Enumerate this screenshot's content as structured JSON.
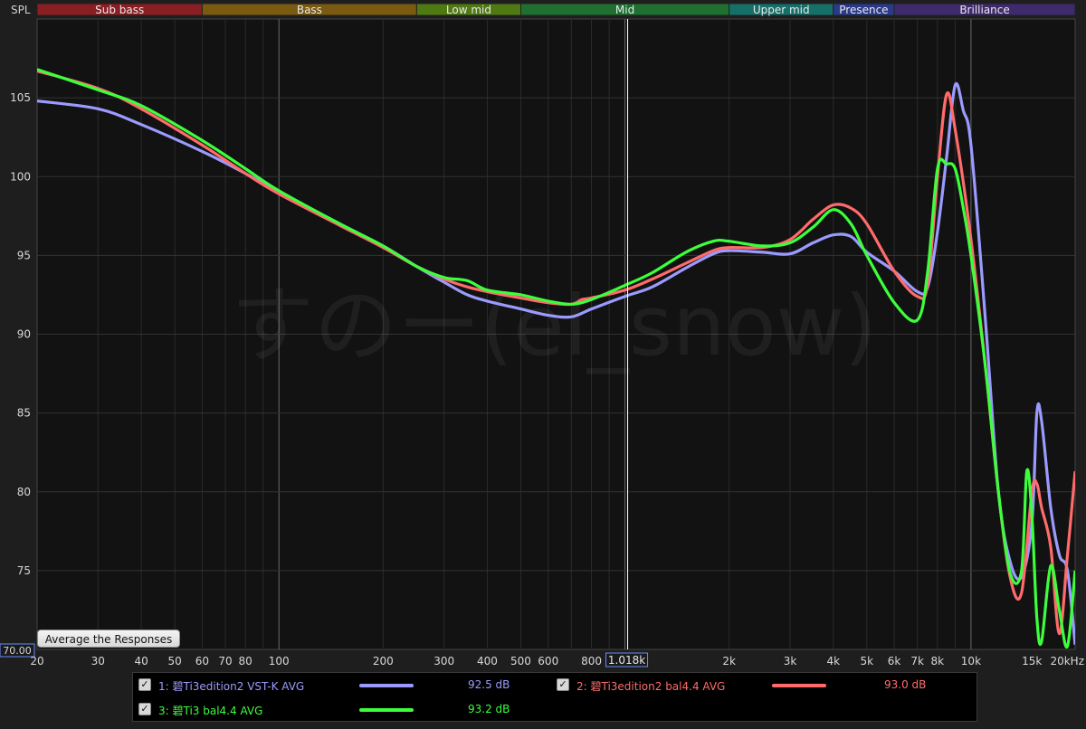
{
  "chart_data": {
    "type": "line",
    "ylabel": "SPL",
    "xscale": "log",
    "xlim": [
      20,
      20000
    ],
    "ylim": [
      70,
      110
    ],
    "grid": true,
    "y_ticks": [
      "75",
      "80",
      "85",
      "90",
      "95",
      "100",
      "105"
    ],
    "y_min_label": "70.00",
    "x_ticks": [
      "20",
      "30",
      "40",
      "50",
      "60",
      "70",
      "80",
      "100",
      "200",
      "300",
      "400",
      "500",
      "600",
      "800",
      "2k",
      "3k",
      "4k",
      "5k",
      "6k",
      "7k",
      "8k",
      "10k",
      "15k",
      "20kHz"
    ],
    "cursor_label": "1.018k",
    "watermark": "すのー(el_snow)",
    "bands": [
      {
        "name": "Sub bass",
        "from": 20,
        "to": 60,
        "color": "#8b1e23"
      },
      {
        "name": "Bass",
        "from": 60,
        "to": 250,
        "color": "#7a5a10"
      },
      {
        "name": "Low mid",
        "from": 250,
        "to": 500,
        "color": "#4f7a12"
      },
      {
        "name": "Mid",
        "from": 500,
        "to": 2000,
        "color": "#1f7030"
      },
      {
        "name": "Upper mid",
        "from": 2000,
        "to": 4000,
        "color": "#16706a"
      },
      {
        "name": "Presence",
        "from": 4000,
        "to": 6000,
        "color": "#2a3a8a"
      },
      {
        "name": "Brilliance",
        "from": 6000,
        "to": 20000,
        "color": "#3f2a6e"
      }
    ],
    "series": [
      {
        "name": "1: 碧Ti3edition2 VST-K AVG",
        "color": "#9b9bff",
        "avg": "92.5 dB",
        "points": [
          [
            20,
            104.8
          ],
          [
            30,
            104.3
          ],
          [
            40,
            103.3
          ],
          [
            60,
            101.6
          ],
          [
            80,
            100.2
          ],
          [
            100,
            99.0
          ],
          [
            150,
            97.0
          ],
          [
            200,
            95.6
          ],
          [
            250,
            94.3
          ],
          [
            300,
            93.3
          ],
          [
            350,
            92.5
          ],
          [
            400,
            92.1
          ],
          [
            500,
            91.6
          ],
          [
            600,
            91.2
          ],
          [
            700,
            91.1
          ],
          [
            800,
            91.6
          ],
          [
            1000,
            92.4
          ],
          [
            1200,
            93.0
          ],
          [
            1500,
            94.2
          ],
          [
            1800,
            95.1
          ],
          [
            2000,
            95.3
          ],
          [
            2500,
            95.2
          ],
          [
            3000,
            95.1
          ],
          [
            3500,
            95.8
          ],
          [
            4000,
            96.3
          ],
          [
            4500,
            96.2
          ],
          [
            5000,
            95.2
          ],
          [
            6000,
            94.0
          ],
          [
            7000,
            92.7
          ],
          [
            7500,
            93.0
          ],
          [
            8000,
            96.5
          ],
          [
            8500,
            101.2
          ],
          [
            9000,
            105.8
          ],
          [
            9500,
            104.2
          ],
          [
            10000,
            102.0
          ],
          [
            11000,
            91.0
          ],
          [
            12000,
            80.0
          ],
          [
            13000,
            75.5
          ],
          [
            14000,
            74.6
          ],
          [
            15000,
            78.0
          ],
          [
            15500,
            85.0
          ],
          [
            16000,
            84.5
          ],
          [
            17000,
            79.0
          ],
          [
            18000,
            76.0
          ],
          [
            19000,
            75.0
          ],
          [
            20000,
            70.3
          ]
        ]
      },
      {
        "name": "2: 碧Ti3edition2 bal4.4 AVG",
        "color": "#ff6b6b",
        "avg": "93.0 dB",
        "points": [
          [
            20,
            106.7
          ],
          [
            30,
            105.6
          ],
          [
            40,
            104.3
          ],
          [
            60,
            102.0
          ],
          [
            80,
            100.2
          ],
          [
            100,
            98.9
          ],
          [
            150,
            96.9
          ],
          [
            200,
            95.5
          ],
          [
            250,
            94.3
          ],
          [
            300,
            93.5
          ],
          [
            350,
            93.0
          ],
          [
            400,
            92.7
          ],
          [
            500,
            92.3
          ],
          [
            600,
            92.0
          ],
          [
            700,
            91.9
          ],
          [
            750,
            92.2
          ],
          [
            800,
            92.3
          ],
          [
            1000,
            92.8
          ],
          [
            1200,
            93.5
          ],
          [
            1500,
            94.5
          ],
          [
            1800,
            95.3
          ],
          [
            2000,
            95.5
          ],
          [
            2500,
            95.5
          ],
          [
            3000,
            96.0
          ],
          [
            3500,
            97.3
          ],
          [
            4000,
            98.2
          ],
          [
            4500,
            98.0
          ],
          [
            5000,
            97.0
          ],
          [
            6000,
            94.0
          ],
          [
            7000,
            92.4
          ],
          [
            7500,
            93.2
          ],
          [
            8000,
            100.0
          ],
          [
            8500,
            105.2
          ],
          [
            9000,
            103.0
          ],
          [
            10000,
            96.0
          ],
          [
            11000,
            88.0
          ],
          [
            12000,
            80.0
          ],
          [
            13000,
            74.5
          ],
          [
            14000,
            73.6
          ],
          [
            15000,
            80.0
          ],
          [
            15500,
            80.5
          ],
          [
            16000,
            79.0
          ],
          [
            17000,
            76.5
          ],
          [
            18000,
            71.0
          ],
          [
            19000,
            76.0
          ],
          [
            20000,
            81.3
          ]
        ]
      },
      {
        "name": "3: 碧Ti3 bal4.4 AVG",
        "color": "#3cff3c",
        "avg": "93.2 dB",
        "points": [
          [
            20,
            106.8
          ],
          [
            30,
            105.5
          ],
          [
            40,
            104.5
          ],
          [
            60,
            102.3
          ],
          [
            80,
            100.5
          ],
          [
            100,
            99.1
          ],
          [
            150,
            97.0
          ],
          [
            200,
            95.6
          ],
          [
            250,
            94.3
          ],
          [
            300,
            93.6
          ],
          [
            350,
            93.4
          ],
          [
            400,
            92.8
          ],
          [
            500,
            92.5
          ],
          [
            600,
            92.1
          ],
          [
            700,
            91.9
          ],
          [
            800,
            92.2
          ],
          [
            1000,
            93.1
          ],
          [
            1200,
            93.9
          ],
          [
            1500,
            95.2
          ],
          [
            1800,
            95.9
          ],
          [
            2000,
            95.9
          ],
          [
            2500,
            95.6
          ],
          [
            3000,
            95.8
          ],
          [
            3500,
            96.8
          ],
          [
            4000,
            97.9
          ],
          [
            4500,
            97.0
          ],
          [
            5000,
            95.0
          ],
          [
            6000,
            92.0
          ],
          [
            7000,
            90.9
          ],
          [
            7500,
            94.0
          ],
          [
            8000,
            100.5
          ],
          [
            8500,
            100.8
          ],
          [
            9000,
            100.5
          ],
          [
            9500,
            98.0
          ],
          [
            10000,
            95.0
          ],
          [
            11000,
            88.0
          ],
          [
            12000,
            80.0
          ],
          [
            13000,
            74.8
          ],
          [
            14000,
            75.0
          ],
          [
            14500,
            81.3
          ],
          [
            15000,
            78.5
          ],
          [
            15500,
            72.0
          ],
          [
            16000,
            70.5
          ],
          [
            17000,
            75.3
          ],
          [
            18000,
            72.5
          ],
          [
            19000,
            70.2
          ],
          [
            20000,
            75.0
          ]
        ]
      }
    ]
  },
  "ui": {
    "average_button_label": "Average the Responses",
    "checkbox_mark": "✓"
  }
}
